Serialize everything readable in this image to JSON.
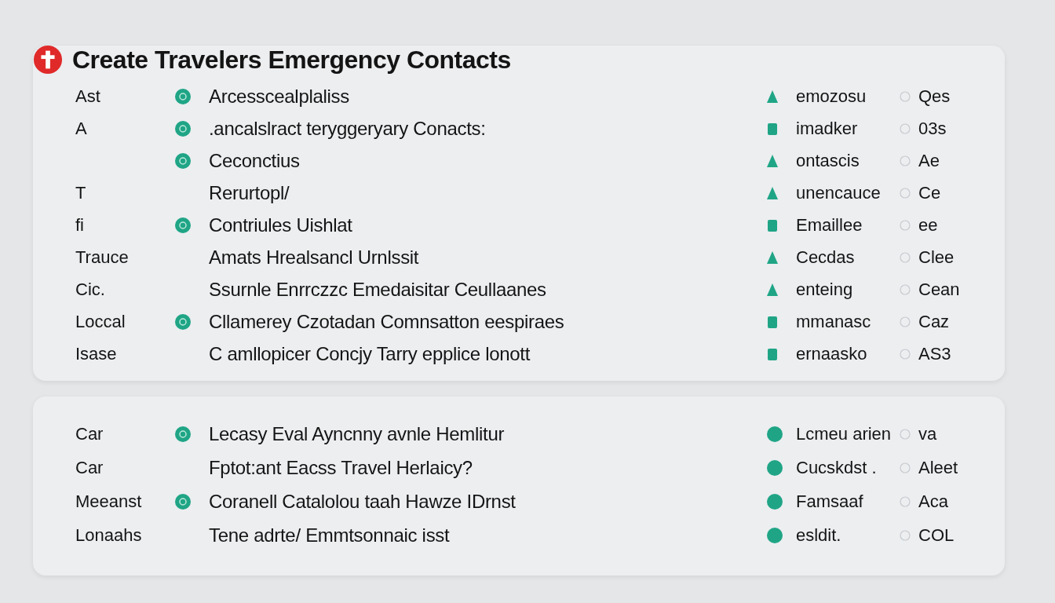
{
  "title": "Create Travelers Emergency Contacts",
  "sections": [
    {
      "rows": [
        {
          "label": "Ast",
          "icon": true,
          "text": "Arcesscealplaliss",
          "right": {
            "kind": "triangle",
            "name": "emozosu",
            "code": "Qes"
          }
        },
        {
          "label": "A",
          "icon": true,
          "text": ".ancalslract teryggeryary Conacts:",
          "right": {
            "kind": "square",
            "name": "imadker",
            "code": "03s"
          }
        },
        {
          "icon": true,
          "text": "Ceconctius",
          "right": {
            "kind": "triangle",
            "name": "ontascis",
            "code": "Ae"
          }
        },
        {
          "label": "T",
          "icon": false,
          "text": "Rerurtopl/",
          "right": {
            "kind": "triangle",
            "name": "unencauce",
            "code": "Ce"
          }
        },
        {
          "label": "fi",
          "icon": true,
          "text": "Contriules Uishlat",
          "right": {
            "kind": "square",
            "name": "Emaillee",
            "code": "ee"
          }
        },
        {
          "label": "Trauce",
          "icon": false,
          "text": "Amats Hrealsancl Urnlssit",
          "right": {
            "kind": "triangle",
            "name": "Cecdas",
            "code": "Clee"
          }
        },
        {
          "label": "Cic.",
          "icon": false,
          "text": "Ssurnle Enrrczzc Emedaisitar Ceullaanes",
          "right": {
            "kind": "triangle",
            "name": "enteing",
            "code": "Cean"
          }
        },
        {
          "label": "Loccal",
          "icon": true,
          "text": "Cllamerey  Czotadan Comnsatton eespiraes",
          "right": {
            "kind": "square",
            "name": "mmanasc",
            "code": "Caz"
          }
        },
        {
          "label": "Isase",
          "icon": false,
          "text": "C amllopicer Concjy Tarry epplice lonott",
          "right": {
            "kind": "square",
            "name": "ernaasko",
            "code": "AS3"
          }
        }
      ]
    },
    {
      "rows": [
        {
          "label": "Car",
          "icon": true,
          "text": "Lecasy Eval Ayncnny avnle Hemlitur",
          "right": {
            "kind": "circle",
            "name": "Lcmeu arien",
            "code": "va"
          }
        },
        {
          "label": "Car",
          "icon": false,
          "text": "Fptot:ant Eacss Travel Herlaicy?",
          "right": {
            "kind": "circle",
            "name": "Cucskdst .",
            "code": "Aleet"
          }
        },
        {
          "label": "Meeanst",
          "icon": true,
          "text": "Coranell Catalolou taah Hawze IDrnst",
          "right": {
            "kind": "circle",
            "name": "Famsaaf",
            "code": "Aca"
          }
        },
        {
          "label": "Lonaahs",
          "icon": false,
          "text": "Tene adrte/ Emmtsonnaic isst",
          "right": {
            "kind": "circle",
            "name": "esldit.",
            "code": "COL"
          }
        }
      ]
    }
  ]
}
